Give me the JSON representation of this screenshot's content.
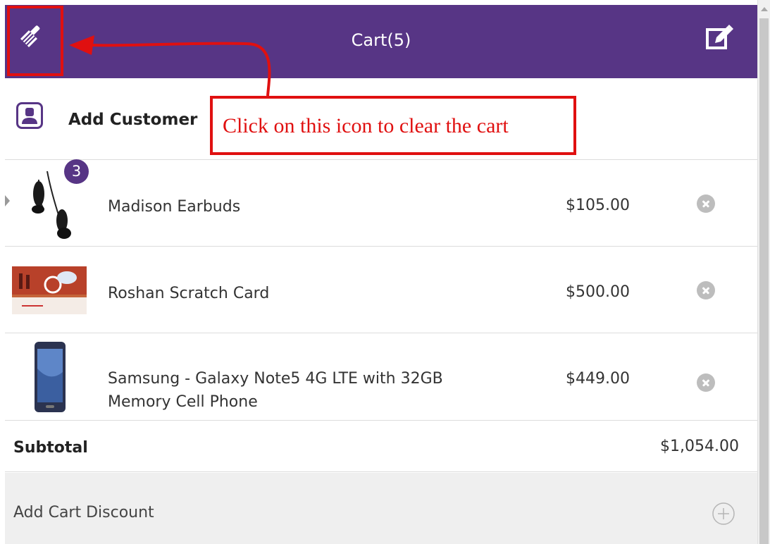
{
  "header": {
    "title": "Cart(5)",
    "clear_icon": "broom-icon",
    "edit_icon": "edit-note-icon",
    "background_color": "#573585"
  },
  "customer": {
    "label": "Add Customer",
    "icon": "user-icon"
  },
  "items": [
    {
      "name": "Madison Earbuds",
      "price": "$105.00",
      "quantity": "3",
      "thumb": "earbuds-image"
    },
    {
      "name": "Roshan Scratch Card",
      "price": "$500.00",
      "thumb": "scratch-card-image"
    },
    {
      "name_line1": "Samsung - Galaxy Note5 4G LTE with 32GB",
      "name_line2": "Memory Cell Phone",
      "price": "$449.00",
      "thumb": "phone-image"
    }
  ],
  "subtotal": {
    "label": "Subtotal",
    "value": "$1,054.00"
  },
  "discount": {
    "label": "Add Cart Discount",
    "icon": "plus-circle-icon"
  },
  "annotation": {
    "text": "Click on this icon to clear the cart",
    "color": "#e01010"
  }
}
